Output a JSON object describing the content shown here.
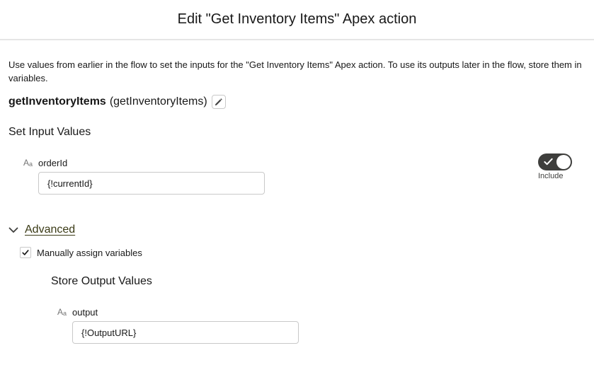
{
  "modal": {
    "title": "Edit \"Get Inventory Items\" Apex action"
  },
  "description": "Use values from earlier in the flow to set the inputs for the \"Get Inventory Items\" Apex action. To use its outputs later in the flow, store them in variables.",
  "action": {
    "name": "getInventoryItems",
    "api_name": "(getInventoryItems)",
    "edit_icon": "pencil-icon"
  },
  "inputs": {
    "section_title": "Set Input Values",
    "fields": [
      {
        "type_icon": "text-type-icon",
        "label": "orderId",
        "value": "{!currentId}",
        "include_toggle": {
          "checked": true,
          "label": "Include"
        }
      }
    ]
  },
  "advanced": {
    "label": "Advanced",
    "expanded": true,
    "manually_assign": {
      "checked": true,
      "label": "Manually assign variables"
    }
  },
  "outputs": {
    "section_title": "Store Output Values",
    "fields": [
      {
        "type_icon": "text-type-icon",
        "label": "output",
        "value": "{!OutputURL}"
      }
    ]
  },
  "colors": {
    "toggle_on": "#3e3e3c",
    "advanced_link": "#3a3a15",
    "border": "#c9c9c9"
  }
}
